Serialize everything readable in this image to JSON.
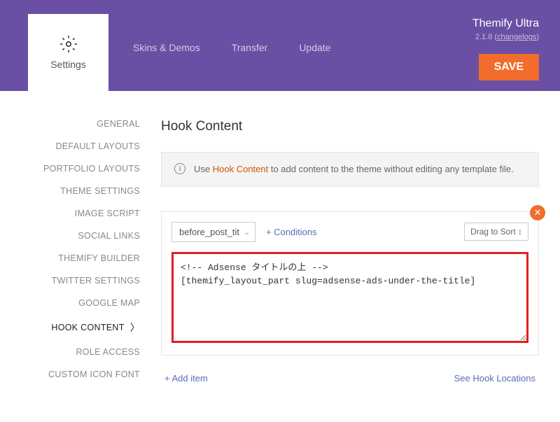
{
  "header": {
    "active_tab": "Settings",
    "nav": [
      "Skins & Demos",
      "Transfer",
      "Update"
    ],
    "theme_name": "Themify Ultra",
    "version_prefix": "2.1.8 (",
    "changelogs": "changelogs",
    "version_suffix": ")",
    "save": "SAVE"
  },
  "sidebar": [
    "GENERAL",
    "DEFAULT LAYOUTS",
    "PORTFOLIO LAYOUTS",
    "THEME SETTINGS",
    "IMAGE SCRIPT",
    "SOCIAL LINKS",
    "THEMIFY BUILDER",
    "TWITTER SETTINGS",
    "GOOGLE MAP",
    "HOOK CONTENT",
    "ROLE ACCESS",
    "CUSTOM ICON FONT"
  ],
  "active_sidebar": "HOOK CONTENT",
  "main": {
    "title": "Hook Content",
    "info_prefix": "Use ",
    "info_link": "Hook Content",
    "info_suffix": " to add content to the theme without editing any template file.",
    "drag_sort": "Drag to Sort ↕",
    "select_value": "before_post_tit",
    "conditions": "+ Conditions",
    "code": "<!-- Adsense タイトルの上 -->\n[themify_layout_part slug=adsense-ads-under-the-title]",
    "add_item": "+  Add item",
    "see_locations": "See Hook Locations"
  }
}
